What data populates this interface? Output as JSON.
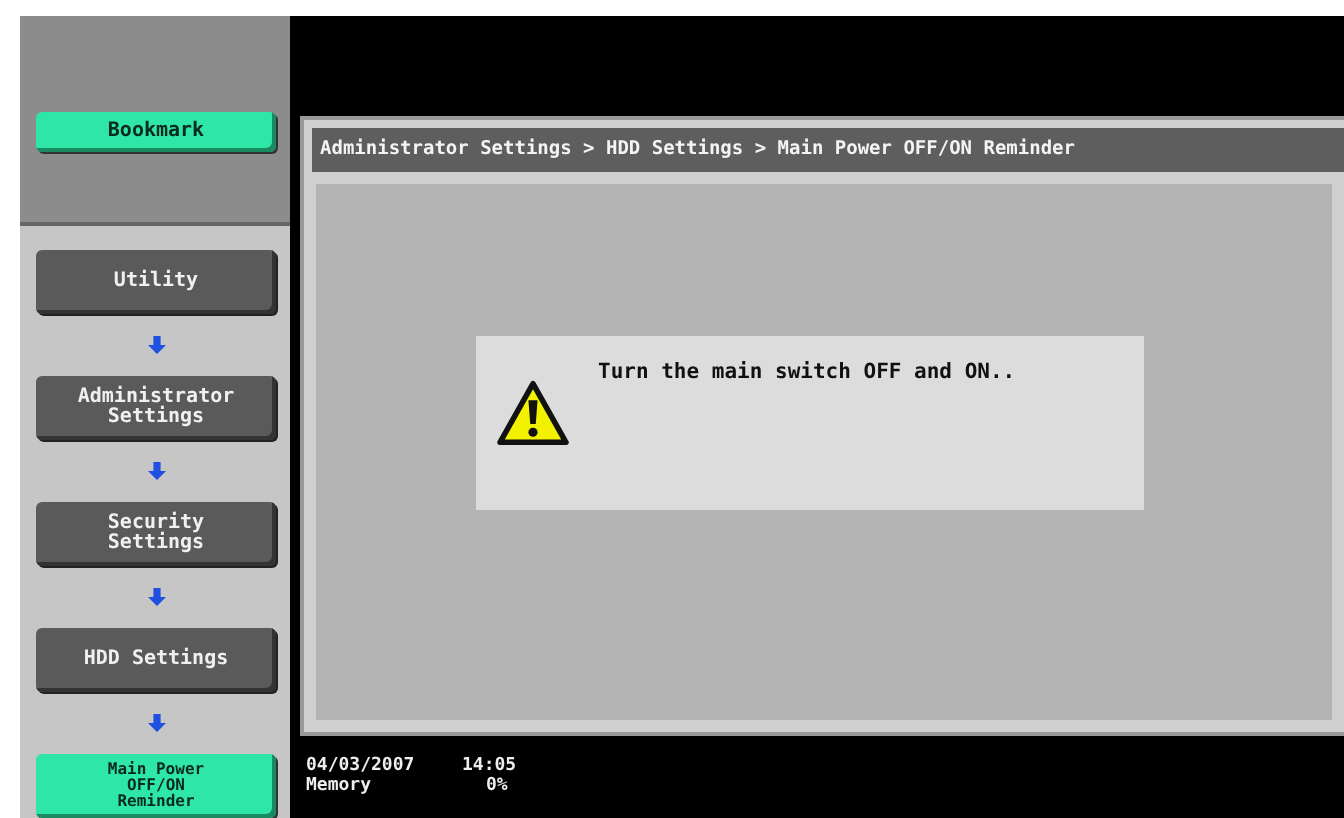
{
  "bookmark": {
    "label": "Bookmark"
  },
  "path": [
    {
      "label": "Utility",
      "selected": false
    },
    {
      "label": "Administrator\nSettings",
      "selected": false
    },
    {
      "label": "Security\nSettings",
      "selected": false
    },
    {
      "label": "HDD Settings",
      "selected": false
    },
    {
      "label": "Main Power\nOFF/ON\nReminder",
      "selected": true
    }
  ],
  "breadcrumb": "Administrator Settings > HDD Settings > Main Power OFF/ON Reminder",
  "dialog": {
    "kind": "warning",
    "message": "Turn the main switch OFF and ON.."
  },
  "status_bar": {
    "date": "04/03/2007",
    "time": "14:05",
    "memory_label": "Memory",
    "memory_value": "0%"
  }
}
